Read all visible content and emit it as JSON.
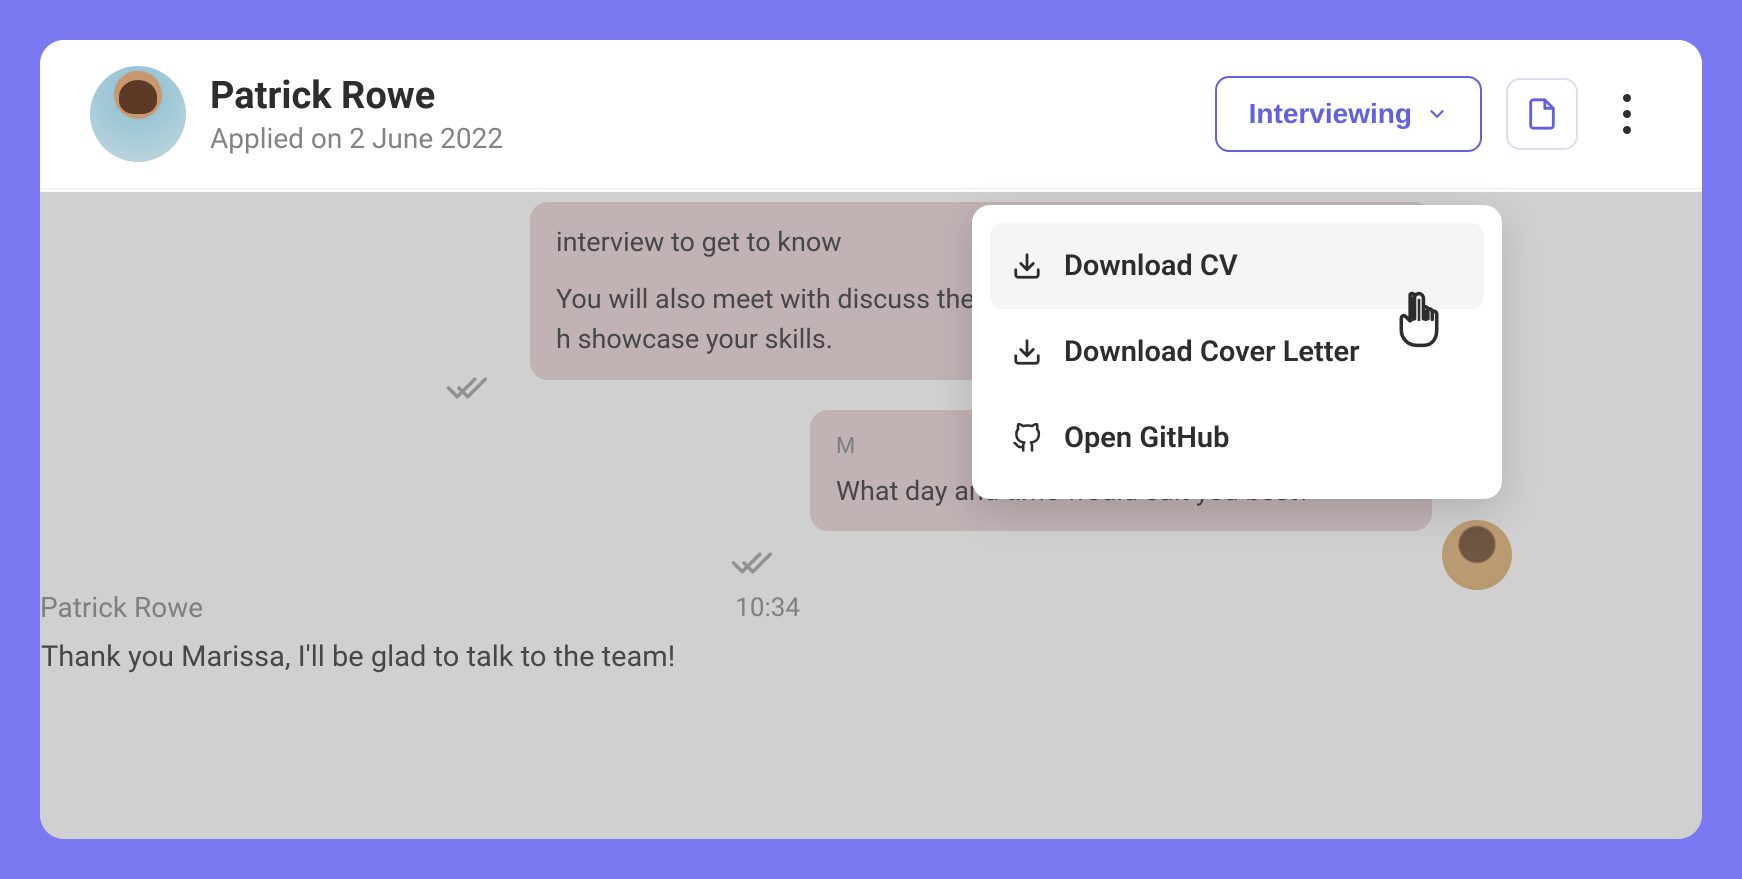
{
  "header": {
    "candidate_name": "Patrick Rowe",
    "applied_label": "Applied on 2 June 2022",
    "status_label": "Interviewing"
  },
  "dropdown": {
    "items": [
      {
        "label": "Download CV",
        "icon": "download"
      },
      {
        "label": "Download Cover Letter",
        "icon": "download"
      },
      {
        "label": "Open GitHub",
        "icon": "github"
      }
    ]
  },
  "messages": {
    "outgoing1": {
      "paragraph1": "interview to get to know",
      "paragraph2": "You will also meet with discuss the role and you like to give you a short h showcase your skills."
    },
    "outgoing2": {
      "sender": "M",
      "text": "What day and time would suit you best?"
    },
    "incoming1": {
      "sender": "Patrick Rowe",
      "time": "10:34",
      "text": "Thank you Marissa, I'll be glad to talk to the team!"
    }
  }
}
